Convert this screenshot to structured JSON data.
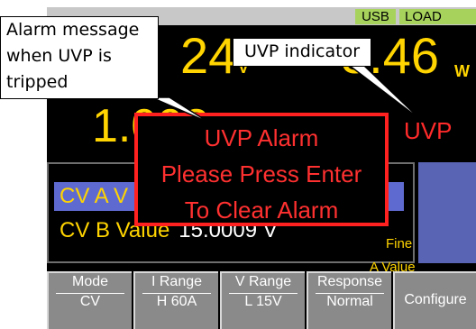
{
  "status": {
    "usb": "USB",
    "load": "LOAD"
  },
  "display": {
    "voltage_partial": "24",
    "voltage_unit": "V",
    "power_partial": "3.46",
    "power_unit": "W",
    "current_partial": "1.003",
    "uvp_indicator": "UVP"
  },
  "cv_panel": {
    "cv_a_label": "CV A V",
    "cv_b_label": "CV B Value",
    "cv_b_value": "15.0009 V"
  },
  "right_panel": {
    "fine": "Fine",
    "a_value": "A Value"
  },
  "soft_keys": {
    "mode_title": "Mode",
    "mode_value": "CV",
    "irange_title": "I Range",
    "irange_value": "H 60A",
    "vrange_title": "V Range",
    "vrange_value": "L 15V",
    "response_title": "Response",
    "response_value": "Normal",
    "configure": "Configure"
  },
  "alarm": {
    "line1": "UVP Alarm",
    "line2": "Please Press Enter",
    "line3": "To Clear Alarm"
  },
  "callouts": {
    "alarm_message": "Alarm message when UVP is tripped",
    "uvp_indicator": "UVP indicator"
  },
  "colors": {
    "accent_yellow": "#ffd400",
    "alarm_red": "#ff2020",
    "status_green": "#a7d35c",
    "highlight_blue": "#5f6ad0"
  }
}
